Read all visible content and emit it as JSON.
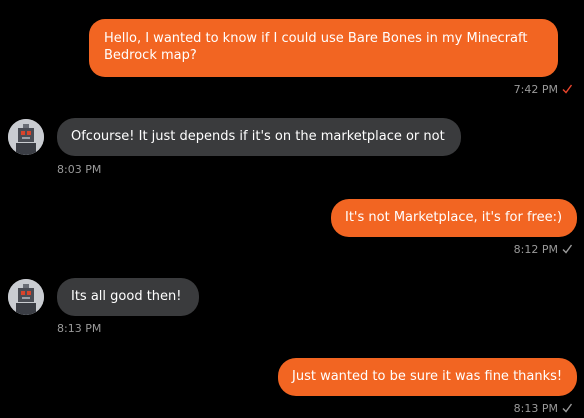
{
  "messages": [
    {
      "direction": "outgoing",
      "text": "Hello, I wanted to know if I could use Bare Bones in my Minecraft Bedrock map?",
      "time": "7:42 PM",
      "status": "read"
    },
    {
      "direction": "incoming",
      "text": "Ofcourse! It just depends if it's on the marketplace or not",
      "time": "8:03 PM"
    },
    {
      "direction": "outgoing",
      "text": "It's not Marketplace, it's for free:)",
      "time": "8:12 PM",
      "status": "delivered"
    },
    {
      "direction": "incoming",
      "text": "Its all good then!",
      "time": "8:13 PM"
    },
    {
      "direction": "outgoing",
      "text": "Just wanted to be sure it was fine thanks!",
      "time": "8:13 PM",
      "status": "delivered"
    }
  ],
  "colors": {
    "background": "#000000",
    "outgoing_bubble": "#f26522",
    "incoming_bubble": "#3a3b3d",
    "read_check": "#e8452c",
    "delivered_check": "#9a9a9a"
  },
  "icons": {
    "read_status": "check-icon",
    "delivered_status": "check-icon",
    "avatar": "robot-avatar"
  }
}
